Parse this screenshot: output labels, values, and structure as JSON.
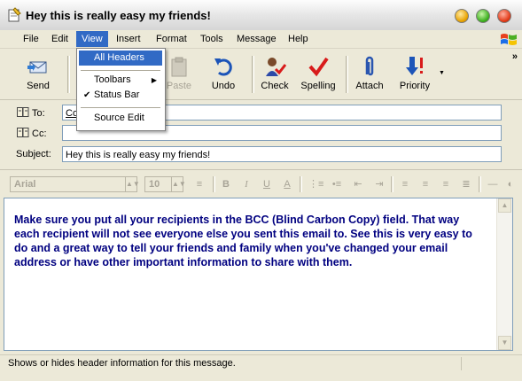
{
  "window": {
    "title": "Hey this is really easy my friends!"
  },
  "menu": [
    "File",
    "Edit",
    "View",
    "Insert",
    "Format",
    "Tools",
    "Message",
    "Help"
  ],
  "view_menu": {
    "all_headers": "All Headers",
    "toolbars": "Toolbars",
    "status_bar": "Status Bar",
    "source_edit": "Source Edit"
  },
  "toolbar": {
    "send": "Send",
    "paste": "Paste",
    "undo": "Undo",
    "check": "Check",
    "spelling": "Spelling",
    "attach": "Attach",
    "priority": "Priority",
    "more": "»"
  },
  "fields": {
    "to_label": "To:",
    "to_value": "Co",
    "cc_label": "Cc:",
    "cc_value": "",
    "subject_label": "Subject:",
    "subject_value": "Hey this is really easy my friends!"
  },
  "format": {
    "font": "Arial",
    "size": "10"
  },
  "body_text": "Make sure you put all your recipients in the BCC (Blind Carbon Copy) field. That way each recipient will not see everyone else you sent this email to. See this is very easy to do and a great way to tell your friends and family when you've changed your email address or have other important information to share with them.",
  "status": "Shows or hides header information for this message.",
  "colors": {
    "menu_highlight": "#316AC5",
    "body_text": "#000080",
    "background": "#ECE9D8"
  }
}
